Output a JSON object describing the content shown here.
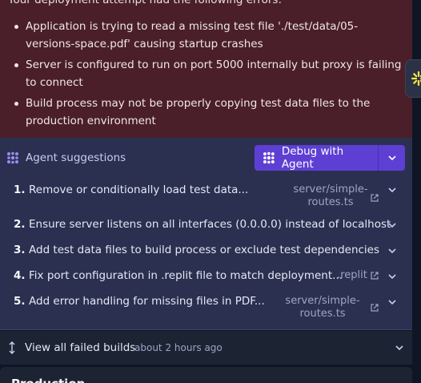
{
  "error_panel": {
    "intro": "Your deployment attempt had the following errors:",
    "errors": [
      "Application is trying to read a missing test file './test/data/05-versions-space.pdf' causing startup crashes",
      "Server is configured to run on port 5000 internally but proxy is failing to connect",
      "Build process may not be properly copying test data files to the production environment"
    ]
  },
  "agent": {
    "title": "Agent suggestions",
    "debug_label": "Debug with Agent",
    "suggestions": [
      {
        "num": "1.",
        "text": "Remove or conditionally load test data...",
        "file": "server/simple-routes.ts"
      },
      {
        "num": "2.",
        "text": "Ensure server listens on all interfaces (0.0.0.0) instead of localhost",
        "file": ""
      },
      {
        "num": "3.",
        "text": "Add test data files to build process or exclude test dependencies",
        "file": ""
      },
      {
        "num": "4.",
        "text": "Fix port configuration in .replit file to match deployment...",
        "file": ".replit"
      },
      {
        "num": "5.",
        "text": "Add error handling for missing files in PDF...",
        "file": "server/simple-routes.ts"
      }
    ]
  },
  "failed_builds": {
    "label": "View all failed builds",
    "time": "about 2 hours ago"
  },
  "next_section": {
    "title": "Production"
  },
  "colors": {
    "error_bg": "#4a1f2a",
    "agent_bg": "#2b3050",
    "accent": "#5e3fd3",
    "assistant_icon": "#f5e642"
  }
}
